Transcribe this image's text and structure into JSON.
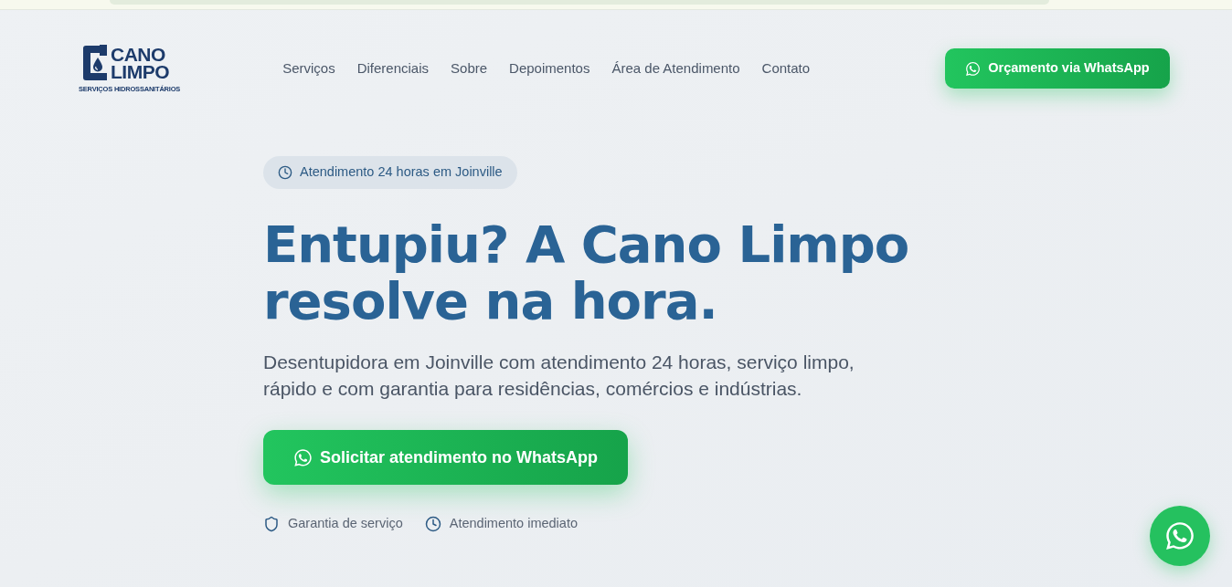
{
  "header": {
    "logo": {
      "line_1": "CANO",
      "line_2": "LIMPO",
      "tagline": "SERVIÇOS HIDROSSANITÁRIOS"
    },
    "nav": [
      {
        "label": "Serviços"
      },
      {
        "label": "Diferenciais"
      },
      {
        "label": "Sobre"
      },
      {
        "label": "Depoimentos"
      },
      {
        "label": "Área de Atendimento"
      },
      {
        "label": "Contato"
      }
    ],
    "cta": "Orçamento via WhatsApp"
  },
  "hero": {
    "badge": "Atendimento 24 horas em Joinville",
    "title": "Entupiu? A Cano Limpo resolve na hora.",
    "subtitle": "Desentupidora em Joinville com atendimento 24 horas, serviço limpo, rápido e com garantia para residências, comércios e indústrias.",
    "cta": "Solicitar atendimento no WhatsApp",
    "features": [
      {
        "kind": "shield",
        "label": "Garantia de serviço"
      },
      {
        "kind": "clock",
        "label": "Atendimento imediato"
      }
    ]
  }
}
